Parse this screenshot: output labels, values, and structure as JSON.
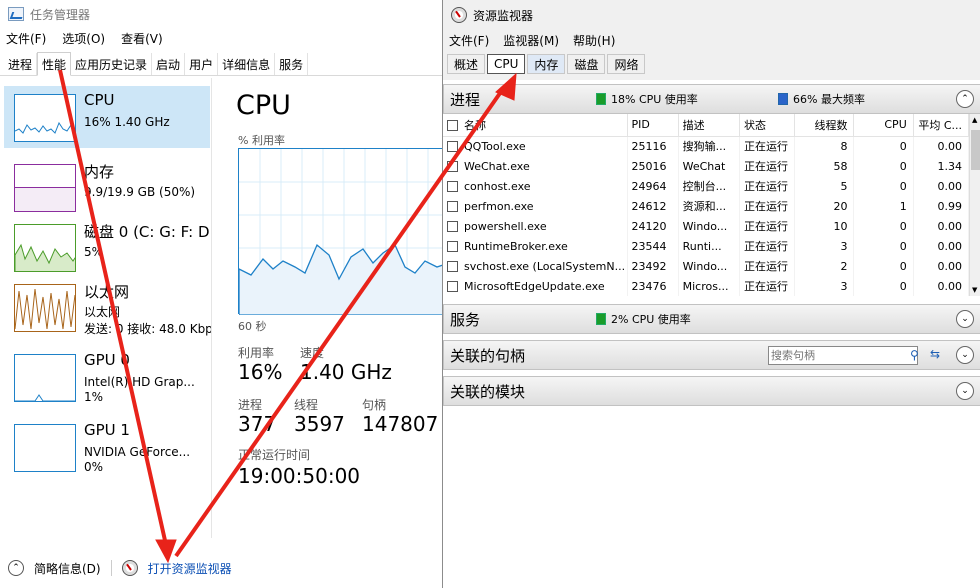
{
  "task_manager": {
    "title": "任务管理器",
    "menu": [
      "文件(F)",
      "选项(O)",
      "查看(V)"
    ],
    "tabs": [
      "进程",
      "性能",
      "应用历史记录",
      "启动",
      "用户",
      "详细信息",
      "服务"
    ],
    "active_tab": "性能",
    "sidebar": [
      {
        "title": "CPU",
        "sub": "16% 1.40 GHz",
        "sub2": ""
      },
      {
        "title": "内存",
        "sub": "9.9/19.9 GB (50%)",
        "sub2": ""
      },
      {
        "title": "磁盘 0 (C: G: F: D",
        "sub": "5%",
        "sub2": ""
      },
      {
        "title": "以太网",
        "sub": "以太网",
        "sub2": "发送: 0 接收: 48.0 Kbp"
      },
      {
        "title": "GPU 0",
        "sub": "Intel(R) HD Grap...",
        "sub2": "1%"
      },
      {
        "title": "GPU 1",
        "sub": "NVIDIA GeForce...",
        "sub2": "0%"
      }
    ],
    "main": {
      "title": "CPU",
      "utilization_label": "% 利用率",
      "seconds_label": "60 秒",
      "stats": {
        "util_label": "利用率",
        "util_value": "16%",
        "speed_label": "速度",
        "speed_value": "1.40 GHz",
        "proc_label": "进程",
        "proc_value": "377",
        "thread_label": "线程",
        "thread_value": "3597",
        "handle_label": "句柄",
        "handle_value": "147807",
        "uptime_label": "正常运行时间",
        "uptime_value": "19:00:50:00"
      }
    },
    "footer": {
      "summary": "简略信息(D)",
      "open_monitor": "打开资源监视器"
    }
  },
  "resource_monitor": {
    "title": "资源监视器",
    "menu": [
      "文件(F)",
      "监视器(M)",
      "帮助(H)"
    ],
    "tabs": [
      "概述",
      "CPU",
      "内存",
      "磁盘",
      "网络"
    ],
    "active_tab": "CPU",
    "processes": {
      "header": "进程",
      "stat1": "18% CPU 使用率",
      "stat2": "66% 最大频率",
      "columns": [
        "名称",
        "PID",
        "描述",
        "状态",
        "线程数",
        "CPU",
        "平均 C..."
      ],
      "rows": [
        [
          "QQTool.exe",
          "25116",
          "搜狗输...",
          "正在运行",
          "8",
          "0",
          "0.00"
        ],
        [
          "WeChat.exe",
          "25016",
          "WeChat",
          "正在运行",
          "58",
          "0",
          "1.34"
        ],
        [
          "conhost.exe",
          "24964",
          "控制台...",
          "正在运行",
          "5",
          "0",
          "0.00"
        ],
        [
          "perfmon.exe",
          "24612",
          "资源和...",
          "正在运行",
          "20",
          "1",
          "0.99"
        ],
        [
          "powershell.exe",
          "24120",
          "Windo...",
          "正在运行",
          "10",
          "0",
          "0.00"
        ],
        [
          "RuntimeBroker.exe",
          "23544",
          "Runti...",
          "正在运行",
          "3",
          "0",
          "0.00"
        ],
        [
          "svchost.exe (LocalSystemN...",
          "23492",
          "Windo...",
          "正在运行",
          "2",
          "0",
          "0.00"
        ],
        [
          "MicrosoftEdgeUpdate.exe",
          "23476",
          "Micros...",
          "正在运行",
          "3",
          "0",
          "0.00"
        ]
      ]
    },
    "services": {
      "header": "服务",
      "stat": "2% CPU 使用率"
    },
    "handles": {
      "header": "关联的句柄",
      "search_placeholder": "搜索句柄"
    },
    "modules": {
      "header": "关联的模块"
    }
  },
  "colors": {
    "arrow": "#e8231a",
    "accent": "#1e81c8",
    "selection": "#cde6f7"
  }
}
